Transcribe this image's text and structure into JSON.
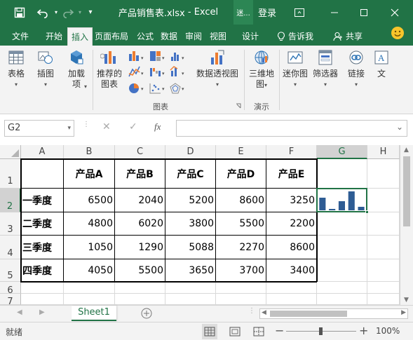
{
  "title": {
    "filename": "产品销售表.xlsx",
    "separator": "-",
    "app": "Excel",
    "context_icon_label": "迷...",
    "login": "登录"
  },
  "tabs": [
    "文件",
    "开始",
    "插入",
    "页面布局",
    "公式",
    "数据",
    "审阅",
    "视图",
    "设计"
  ],
  "active_tab": "插入",
  "tell_me": "告诉我",
  "share": "共享",
  "ribbon": {
    "table": "表格",
    "illustrations": "插图",
    "addins_line1": "加载",
    "addins_line2": "项",
    "rec_charts_line1": "推荐的",
    "rec_charts_line2": "图表",
    "pivot_chart": "数据透视图",
    "map_3d_line1": "三维地",
    "map_3d_line2": "图",
    "sparklines": "迷你图",
    "filters": "筛选器",
    "links": "链接",
    "text_partial": "文",
    "group_charts": "图表",
    "group_tours": "演示"
  },
  "formula_bar": {
    "name_box": "G2",
    "cancel": "✕",
    "enter": "✓",
    "fx": "fx",
    "formula": ""
  },
  "columns": [
    "A",
    "B",
    "C",
    "D",
    "E",
    "F",
    "G",
    "H"
  ],
  "rows": [
    "1",
    "2",
    "3",
    "4",
    "5",
    "6",
    "7"
  ],
  "table": {
    "headers": [
      "产品A",
      "产品B",
      "产品C",
      "产品D",
      "产品E"
    ],
    "quarters": [
      "一季度",
      "二季度",
      "三季度",
      "四季度"
    ],
    "values": [
      [
        "6500",
        "2040",
        "5200",
        "8600",
        "3250"
      ],
      [
        "4800",
        "6020",
        "3800",
        "5500",
        "2200"
      ],
      [
        "1050",
        "1290",
        "5088",
        "2270",
        "8600"
      ],
      [
        "4050",
        "5500",
        "3650",
        "3700",
        "3400"
      ]
    ]
  },
  "sparkline": {
    "type": "column",
    "values": [
      6500,
      2040,
      5200,
      8600,
      3250
    ],
    "color": "#2e5c94"
  },
  "sheet_tab": "Sheet1",
  "status": {
    "ready": "就绪",
    "zoom": "100%",
    "zoom_minus": "−",
    "zoom_plus": "+"
  },
  "colors": {
    "brand": "#217346",
    "selection": "#217346",
    "sparkline": "#2e5c94"
  }
}
